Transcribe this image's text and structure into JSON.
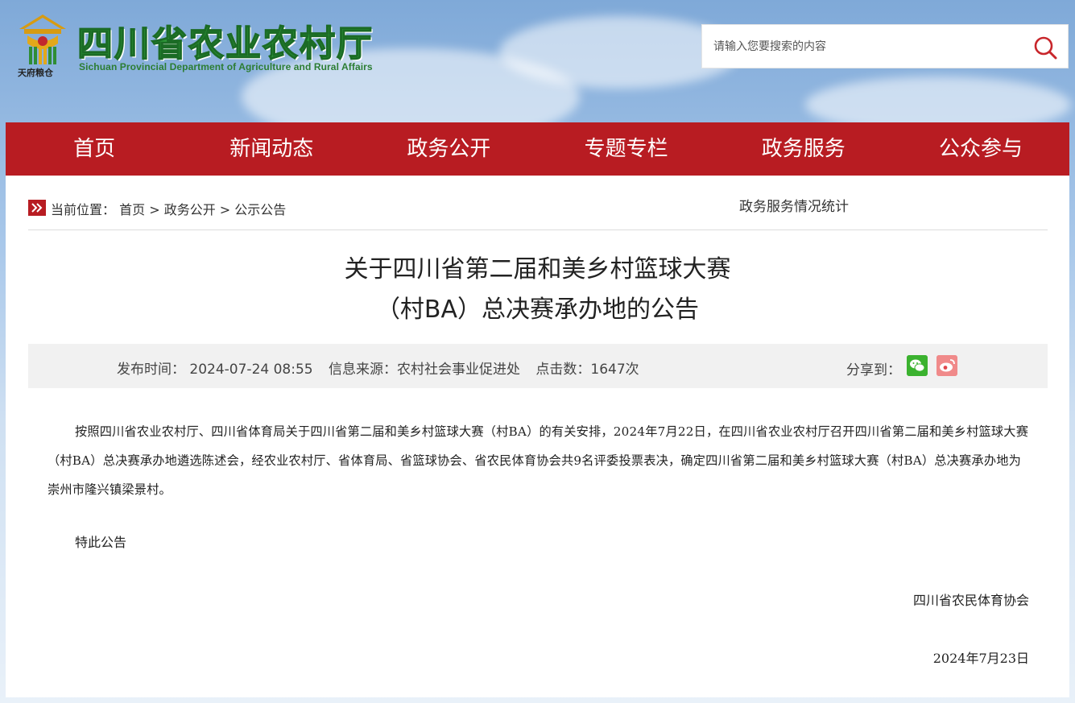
{
  "header": {
    "site_title": "四川省农业农村厅",
    "site_subtitle": "Sichuan Provincial Department of Agriculture and Rural Affairs",
    "emblem_caption": "天府粮仓",
    "search_placeholder": "请输入您要搜索的内容"
  },
  "nav": {
    "items": [
      {
        "label": "首页"
      },
      {
        "label": "新闻动态"
      },
      {
        "label": "政务公开"
      },
      {
        "label": "专题专栏"
      },
      {
        "label": "政务服务"
      },
      {
        "label": "公众参与"
      }
    ]
  },
  "breadcrumb": {
    "prefix": "当前位置：",
    "items": [
      "首页",
      "政务公开",
      "公示公告"
    ],
    "separator": " > "
  },
  "stats_link": "政务服务情况统计",
  "article": {
    "title_line1": "关于四川省第二届和美乡村篮球大赛",
    "title_line2": "（村BA）总决赛承办地的公告",
    "meta": {
      "publish_time": "发布时间：  2024-07-24 08:55",
      "source": "信息来源：农村社会事业促进处",
      "clicks": "点击数：1647次"
    },
    "share_label": "分享到：",
    "body": "按照四川省农业农村厅、四川省体育局关于四川省第二届和美乡村篮球大赛（村BA）的有关安排，2024年7月22日，在四川省农业农村厅召开四川省第二届和美乡村篮球大赛（村BA）总决赛承办地遴选陈述会，经农业农村厅、省体育局、省篮球协会、省农民体育协会共9名评委投票表决，确定四川省第二届和美乡村篮球大赛（村BA）总决赛承办地为崇州市隆兴镇梁景村。",
    "closing": "特此公告",
    "signer": "四川省农民体育协会",
    "date": "2024年7月23日"
  },
  "colors": {
    "nav_red": "#b81c22",
    "logo_green": "#2f9a3a",
    "wechat_green": "#3bb22f",
    "weibo_pink": "#f08a8a"
  }
}
